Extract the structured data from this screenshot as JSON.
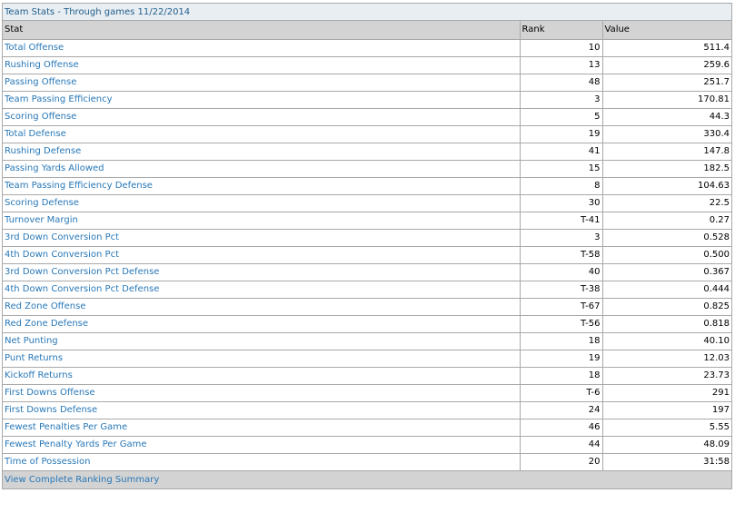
{
  "caption": "Team Stats - Through games 11/22/2014",
  "columns": {
    "stat": "Stat",
    "rank": "Rank",
    "value": "Value"
  },
  "rows": [
    {
      "stat": "Total Offense",
      "rank": "10",
      "value": "511.4"
    },
    {
      "stat": "Rushing Offense",
      "rank": "13",
      "value": "259.6"
    },
    {
      "stat": "Passing Offense",
      "rank": "48",
      "value": "251.7"
    },
    {
      "stat": "Team Passing Efficiency",
      "rank": "3",
      "value": "170.81"
    },
    {
      "stat": "Scoring Offense",
      "rank": "5",
      "value": "44.3"
    },
    {
      "stat": "Total Defense",
      "rank": "19",
      "value": "330.4"
    },
    {
      "stat": "Rushing Defense",
      "rank": "41",
      "value": "147.8"
    },
    {
      "stat": "Passing Yards Allowed",
      "rank": "15",
      "value": "182.5"
    },
    {
      "stat": "Team Passing Efficiency Defense",
      "rank": "8",
      "value": "104.63"
    },
    {
      "stat": "Scoring Defense",
      "rank": "30",
      "value": "22.5"
    },
    {
      "stat": "Turnover Margin",
      "rank": "T-41",
      "value": "0.27"
    },
    {
      "stat": "3rd Down Conversion Pct",
      "rank": "3",
      "value": "0.528"
    },
    {
      "stat": "4th Down Conversion Pct",
      "rank": "T-58",
      "value": "0.500"
    },
    {
      "stat": "3rd Down Conversion Pct Defense",
      "rank": "40",
      "value": "0.367"
    },
    {
      "stat": "4th Down Conversion Pct Defense",
      "rank": "T-38",
      "value": "0.444"
    },
    {
      "stat": "Red Zone Offense",
      "rank": "T-67",
      "value": "0.825"
    },
    {
      "stat": "Red Zone Defense",
      "rank": "T-56",
      "value": "0.818"
    },
    {
      "stat": "Net Punting",
      "rank": "18",
      "value": "40.10"
    },
    {
      "stat": "Punt Returns",
      "rank": "19",
      "value": "12.03"
    },
    {
      "stat": "Kickoff Returns",
      "rank": "18",
      "value": "23.73"
    },
    {
      "stat": "First Downs Offense",
      "rank": "T-6",
      "value": "291"
    },
    {
      "stat": "First Downs Defense",
      "rank": "24",
      "value": "197"
    },
    {
      "stat": "Fewest Penalties Per Game",
      "rank": "46",
      "value": "5.55"
    },
    {
      "stat": "Fewest Penalty Yards Per Game",
      "rank": "44",
      "value": "48.09"
    },
    {
      "stat": "Time of Possession",
      "rank": "20",
      "value": "31:58"
    }
  ],
  "footer_link": "View Complete Ranking Summary",
  "colors": {
    "link": "#2878b8",
    "header_bg": "#d3d3d3",
    "caption_bg": "#e9eef3",
    "border": "#a9a9a9"
  }
}
